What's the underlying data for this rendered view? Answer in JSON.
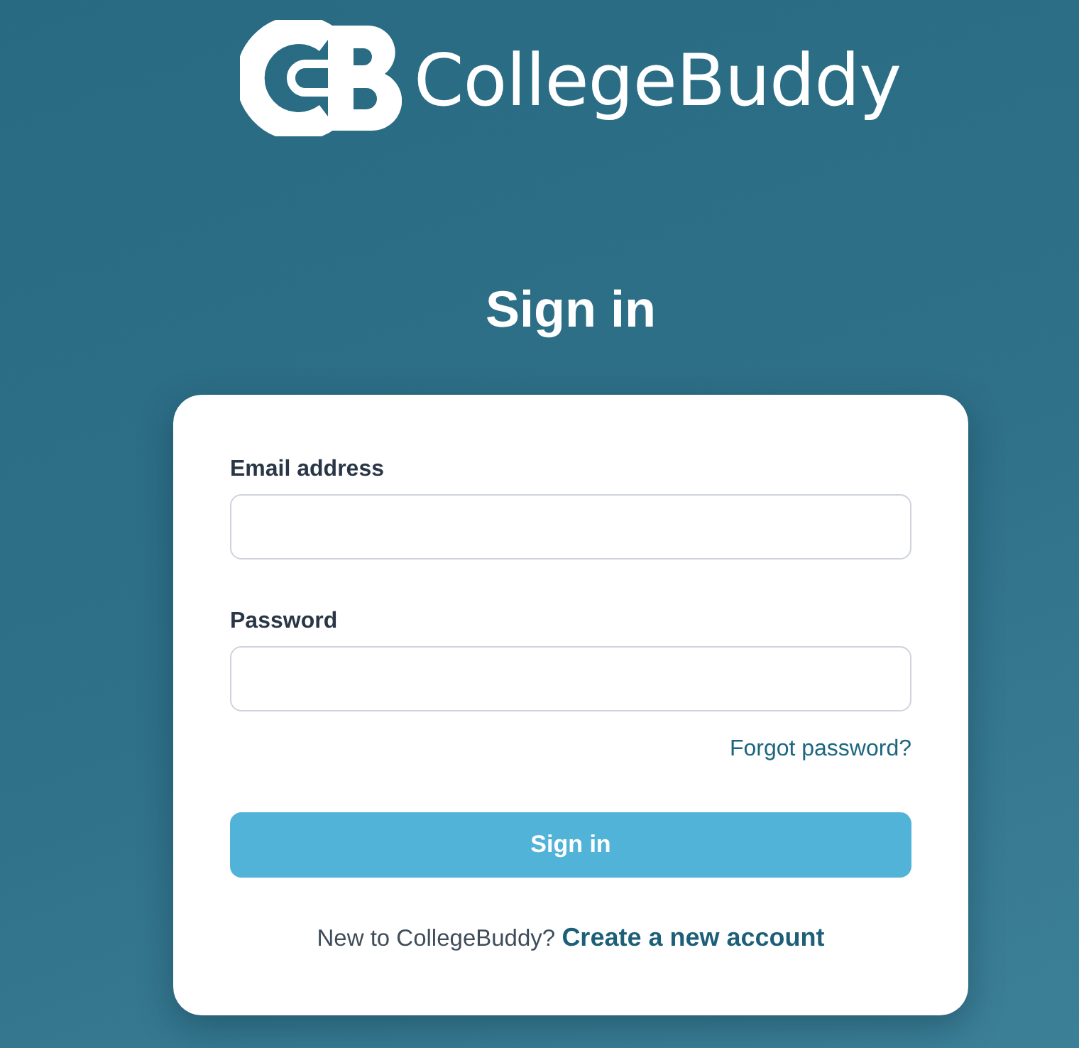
{
  "logo": {
    "name": "CollegeBuddy"
  },
  "heading": "Sign in",
  "form": {
    "fields": [
      {
        "label": "Email address"
      },
      {
        "label": "Password"
      }
    ],
    "forgot_link": "Forgot password?",
    "submit_button": "Sign in",
    "signup_prompt": "New to CollegeBuddy?",
    "signup_link": "Create a new account"
  }
}
